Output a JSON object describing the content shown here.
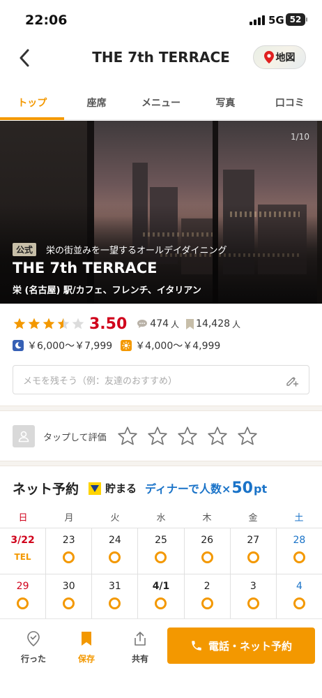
{
  "status_bar": {
    "time": "22:06",
    "network": "5G",
    "battery": "52"
  },
  "header": {
    "title": "THE 7th TERRACE",
    "map_label": "地図"
  },
  "tabs": [
    {
      "label": "トップ",
      "active": true
    },
    {
      "label": "座席"
    },
    {
      "label": "メニュー"
    },
    {
      "label": "写真"
    },
    {
      "label": "口コミ"
    }
  ],
  "hero": {
    "counter": "1/10",
    "badge": "公式",
    "catch_copy": "栄の街並みを一望するオールデイダイニング",
    "name": "THE 7th TERRACE",
    "genre": "栄 (名古屋) 駅/カフェ、フレンチ、イタリアン"
  },
  "rating": {
    "score": "3.50",
    "stars": 3.5,
    "reviews": "474",
    "reviews_unit": "人",
    "saves": "14,428",
    "saves_unit": "人"
  },
  "price": {
    "dinner": "￥6,000～￥7,999",
    "lunch": "￥4,000～￥4,999"
  },
  "memo": {
    "placeholder": "メモを残そう（例：友達のおすすめ）"
  },
  "evaluate": {
    "label": "タップして評価"
  },
  "net_reserve": {
    "title": "ネット予約",
    "tpoint_label": "貯まる",
    "promo_pre": "ディナーで人数×",
    "promo_num": "50",
    "promo_unit": "pt"
  },
  "calendar": {
    "weekdays": [
      "日",
      "月",
      "火",
      "水",
      "木",
      "金",
      "土"
    ],
    "rows": [
      [
        {
          "day": "3/22",
          "status": "TEL"
        },
        {
          "day": "23",
          "status": "available"
        },
        {
          "day": "24",
          "status": "available"
        },
        {
          "day": "25",
          "status": "available"
        },
        {
          "day": "26",
          "status": "available"
        },
        {
          "day": "27",
          "status": "available"
        },
        {
          "day": "28",
          "status": "available"
        }
      ],
      [
        {
          "day": "29",
          "status": "available"
        },
        {
          "day": "30",
          "status": "available"
        },
        {
          "day": "31",
          "status": "available"
        },
        {
          "day": "4/1",
          "status": "available"
        },
        {
          "day": "2",
          "status": "available"
        },
        {
          "day": "3",
          "status": "available"
        },
        {
          "day": "4",
          "status": "available"
        }
      ]
    ]
  },
  "bottom_bar": {
    "visited": "行った",
    "save": "保存",
    "share": "共有",
    "call_reserve": "電話・ネット予約"
  },
  "colors": {
    "accent": "#f39800",
    "score_red": "#d0021b",
    "promo_blue": "#1a73c8"
  }
}
